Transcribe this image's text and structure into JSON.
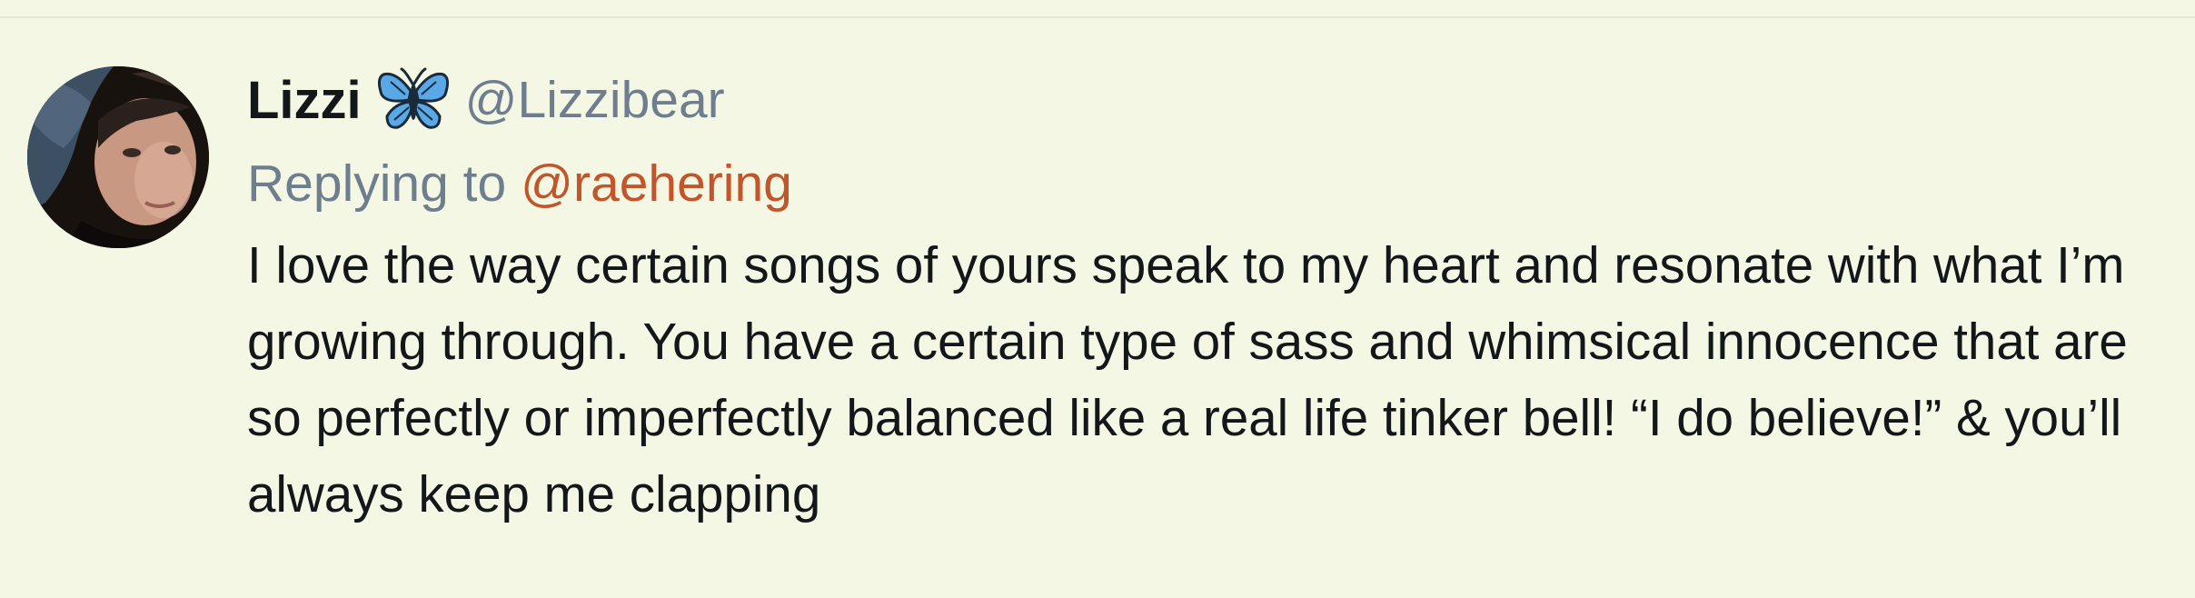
{
  "tweet": {
    "author": {
      "display_name": "Lizzi",
      "emoji_icon": "butterfly-icon",
      "handle": "@Lizzibear"
    },
    "reply": {
      "prefix": "Replying to",
      "target": "@raehering"
    },
    "text": "I love the way certain songs of yours speak to my heart and resonate with what I’m growing through. You have a certain type of sass and whimsical innocence that are so perfectly or imperfectly balanced like a real life tinker bell! “I do believe!” & you’ll always keep me clapping"
  },
  "colors": {
    "background": "#f4f7e4",
    "text": "#14171a",
    "secondary_text": "#6e7e8e",
    "link": "#c2552a",
    "butterfly": "#5aa8e6"
  }
}
